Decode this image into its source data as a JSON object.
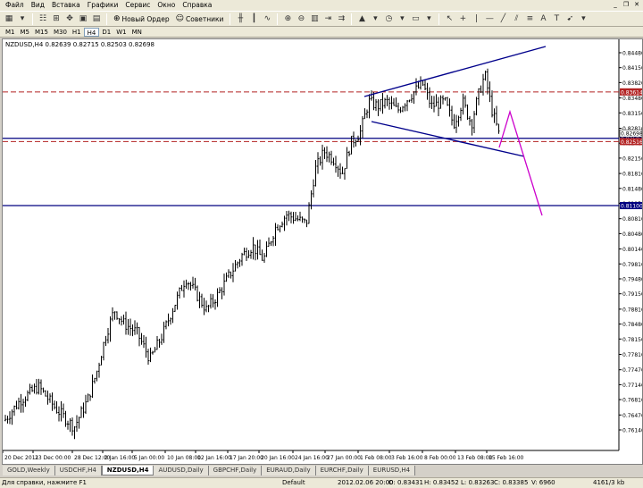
{
  "menu": [
    "Файл",
    "Вид",
    "Вставка",
    "Графики",
    "Сервис",
    "Окно",
    "Справка"
  ],
  "toolbar": {
    "new_order": "Новый Ордер",
    "advisors": "Советники"
  },
  "timeframes": [
    "M1",
    "M5",
    "M15",
    "M30",
    "H1",
    "H4",
    "D1",
    "W1",
    "MN"
  ],
  "active_timeframe": "H4",
  "chart": {
    "symbol_info": "NZDUSD,H4  0.82639 0.82715 0.82503 0.82698",
    "price_axis": [
      "0.84480",
      "0.84150",
      "0.83820",
      "0.83480",
      "0.83150",
      "0.82810",
      "0.82480",
      "0.82150",
      "0.81810",
      "0.81480",
      "0.81150",
      "0.80810",
      "0.80480",
      "0.80140",
      "0.79810",
      "0.79480",
      "0.79150",
      "0.78810",
      "0.78480",
      "0.78150",
      "0.77810",
      "0.77470",
      "0.77140",
      "0.76810",
      "0.76470",
      "0.76140"
    ],
    "time_axis": [
      "20 Dec 2011",
      "23 Dec 00:00",
      "28 Dec 12:00",
      "2 Jan 16:00",
      "5 Jan 00:00",
      "10 Jan 08:00",
      "12 Jan 16:00",
      "17 Jan 20:00",
      "20 Jan 16:00",
      "24 Jan 16:00",
      "27 Jan 00:00",
      "1 Feb 08:00",
      "3 Feb 16:00",
      "8 Feb 00:00",
      "13 Feb 08:00",
      "15 Feb 16:00"
    ],
    "price_tags": {
      "red_top": "0.83614",
      "blue_mid": "0.82587",
      "red_low": "0.82516",
      "blue_low": "0.81100",
      "current": "0.82698"
    },
    "colors": {
      "bull": "#000000",
      "bear": "#000000",
      "hline_blue": "#000080",
      "hline_red": "#b22222",
      "trend": "#00008b",
      "forecast": "#cc00cc"
    }
  },
  "tabs": [
    "GOLD,Weekly",
    "USDCHF,H4",
    "NZDUSD,H4",
    "AUDUSD,Daily",
    "GBPCHF,Daily",
    "EURAUD,Daily",
    "EURCHF,Daily",
    "EURUSD,H4"
  ],
  "active_tab": "NZDUSD,H4",
  "status": {
    "help": "Для справки, нажмите F1",
    "profile": "Default",
    "datetime": "2012.02.06 20:00",
    "open": "O: 0.83431",
    "high": "H: 0.83452",
    "low": "L: 0.83263",
    "close": "C: 0.83385",
    "volume": "V: 6960",
    "traffic": "4161/3 kb"
  }
}
